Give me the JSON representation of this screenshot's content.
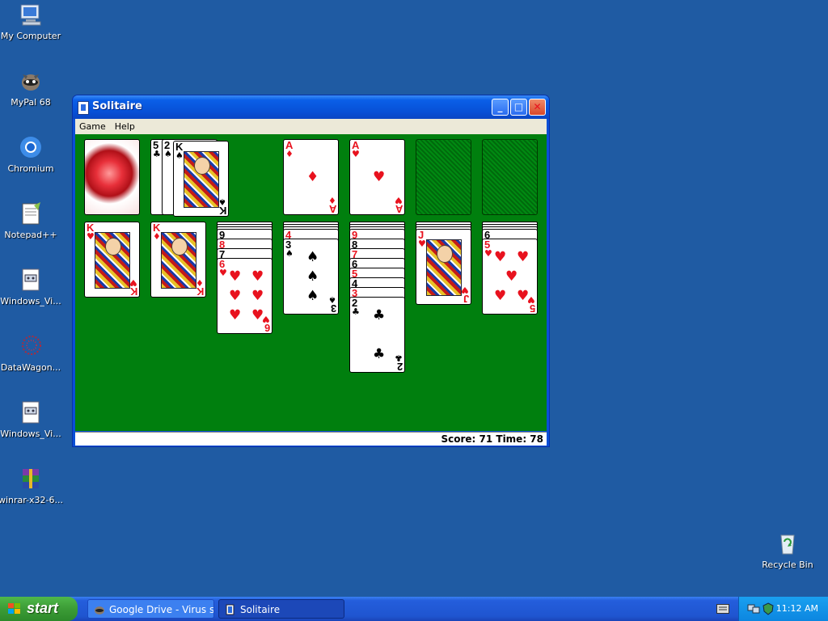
{
  "desktop": {
    "icons": [
      {
        "name": "my-computer-icon",
        "label": "My Computer"
      },
      {
        "name": "mypal-icon",
        "label": "MyPal 68"
      },
      {
        "name": "chromium-icon",
        "label": "Chromium"
      },
      {
        "name": "notepadpp-icon",
        "label": "Notepad++"
      },
      {
        "name": "windows-vi-icon",
        "label": "Windows_Vi..."
      },
      {
        "name": "datawagon-icon",
        "label": "DataWagon..."
      },
      {
        "name": "windows-vi-2-icon",
        "label": "Windows_Vi..."
      },
      {
        "name": "winrar-icon",
        "label": "winrar-x32-6..."
      }
    ],
    "recycle_bin": {
      "label": "Recycle Bin"
    }
  },
  "window": {
    "title": "Solitaire",
    "menu": [
      "Game",
      "Help"
    ],
    "minimize": "_",
    "maximize": "□",
    "close": "✕",
    "status": "Score: 71  Time: 78"
  },
  "game": {
    "waste": [
      {
        "rank": "5",
        "suit": "♣",
        "color": "black"
      },
      {
        "rank": "2",
        "suit": "♠",
        "color": "black"
      },
      {
        "rank": "K",
        "suit": "♠",
        "color": "black"
      }
    ],
    "foundations": [
      {
        "rank": "A",
        "suit": "♦",
        "color": "red"
      },
      {
        "rank": "A",
        "suit": "♥",
        "color": "red"
      }
    ],
    "tableau": [
      {
        "cards": [
          {
            "rank": "K",
            "suit": "♥",
            "color": "red"
          }
        ]
      },
      {
        "cards": [
          {
            "rank": "K",
            "suit": "♦",
            "color": "red"
          }
        ]
      },
      {
        "cards": [
          {
            "rank": "9",
            "suit": "♠",
            "color": "black"
          },
          {
            "rank": "8",
            "suit": "♥",
            "color": "red"
          },
          {
            "rank": "7",
            "suit": "♠",
            "color": "black"
          },
          {
            "rank": "6",
            "suit": "♥",
            "color": "red"
          }
        ]
      },
      {
        "cards": [
          {
            "rank": "4",
            "suit": "♥",
            "color": "red"
          },
          {
            "rank": "3",
            "suit": "♠",
            "color": "black"
          }
        ]
      },
      {
        "cards": [
          {
            "rank": "9",
            "suit": "♥",
            "color": "red"
          },
          {
            "rank": "8",
            "suit": "♠",
            "color": "black"
          },
          {
            "rank": "7",
            "suit": "♥",
            "color": "red"
          },
          {
            "rank": "6",
            "suit": "♠",
            "color": "black"
          },
          {
            "rank": "5",
            "suit": "♥",
            "color": "red"
          },
          {
            "rank": "4",
            "suit": "♠",
            "color": "black"
          },
          {
            "rank": "3",
            "suit": "♥",
            "color": "red"
          },
          {
            "rank": "2",
            "suit": "♣",
            "color": "black"
          }
        ]
      },
      {
        "cards": [
          {
            "rank": "J",
            "suit": "♥",
            "color": "red"
          }
        ]
      },
      {
        "cards": [
          {
            "rank": "6",
            "suit": "♠",
            "color": "black"
          },
          {
            "rank": "5",
            "suit": "♥",
            "color": "red"
          }
        ]
      }
    ]
  },
  "taskbar": {
    "start_label": "start",
    "items": [
      {
        "label": "Google Drive - Virus s..."
      },
      {
        "label": "Solitaire"
      }
    ],
    "clock": "11:12 AM"
  }
}
